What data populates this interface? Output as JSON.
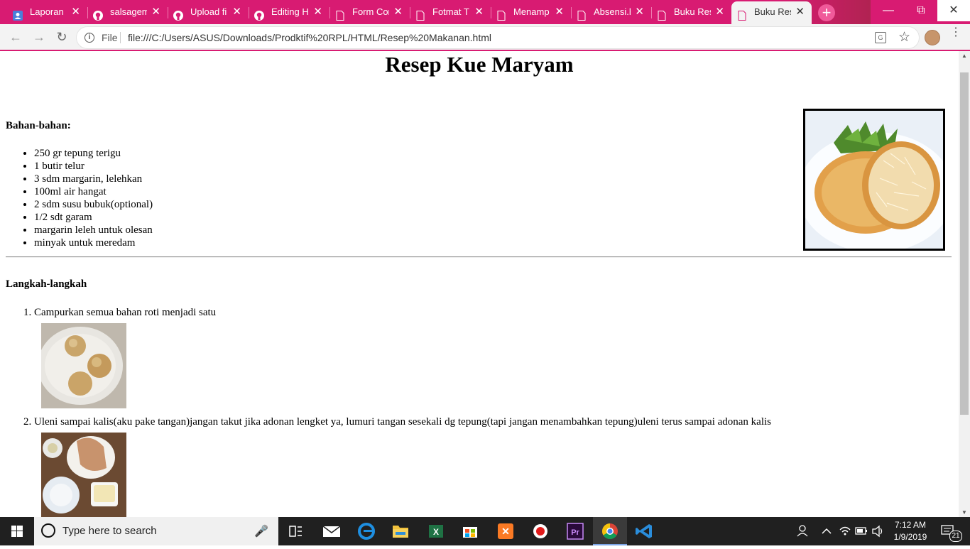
{
  "browser": {
    "tabs": [
      {
        "label": "Laporan I",
        "icon": "contacts-icon",
        "active": false
      },
      {
        "label": "salsagem",
        "icon": "github-icon",
        "active": false
      },
      {
        "label": "Upload fi",
        "icon": "github-icon",
        "active": false
      },
      {
        "label": "Editing H",
        "icon": "github-icon",
        "active": false
      },
      {
        "label": "Form Cor",
        "icon": "document-icon",
        "active": false
      },
      {
        "label": "Fotmat T",
        "icon": "document-icon",
        "active": false
      },
      {
        "label": "Menamp",
        "icon": "document-icon",
        "active": false
      },
      {
        "label": "Absensi.h",
        "icon": "document-icon",
        "active": false
      },
      {
        "label": "Buku Res",
        "icon": "document-icon",
        "active": false
      },
      {
        "label": "Buku Res",
        "icon": "document-icon",
        "active": true
      }
    ],
    "close_glyph": "✕",
    "new_tab_glyph": "+",
    "address": {
      "scheme_label": "File",
      "url": "file:///C:/Users/ASUS/Downloads/Prodktif%20RPL/HTML/Resep%20Makanan.html"
    },
    "accent_color": "#d81b72"
  },
  "page": {
    "title": "Resep Kue Maryam",
    "ingredients_heading": "Bahan-bahan:",
    "ingredients": [
      "250 gr tepung terigu",
      "1 butir telur",
      "3 sdm margarin, lelehkan",
      "100ml air hangat",
      "2 sdm susu bubuk(optional)",
      "1/2 sdt garam",
      "margarin leleh untuk olesan",
      "minyak untuk meredam"
    ],
    "steps_heading": "Langkah-langkah",
    "steps": [
      "Campurkan semua bahan roti menjadi satu",
      "Uleni sampai kalis(aku pake tangan)jangan takut jika adonan lengket ya, lumuri tangan sesekali dg tepung(tapi jangan menambahkan tepung)uleni terus sampai adonan kalis"
    ]
  },
  "taskbar": {
    "search_placeholder": "Type here to search",
    "time": "7:12 AM",
    "date": "1/9/2019",
    "notification_count": "21",
    "apps": [
      "task-view",
      "mail",
      "edge",
      "file-explorer",
      "excel",
      "store",
      "xampp",
      "recorder",
      "premiere",
      "chrome",
      "vscode"
    ]
  }
}
